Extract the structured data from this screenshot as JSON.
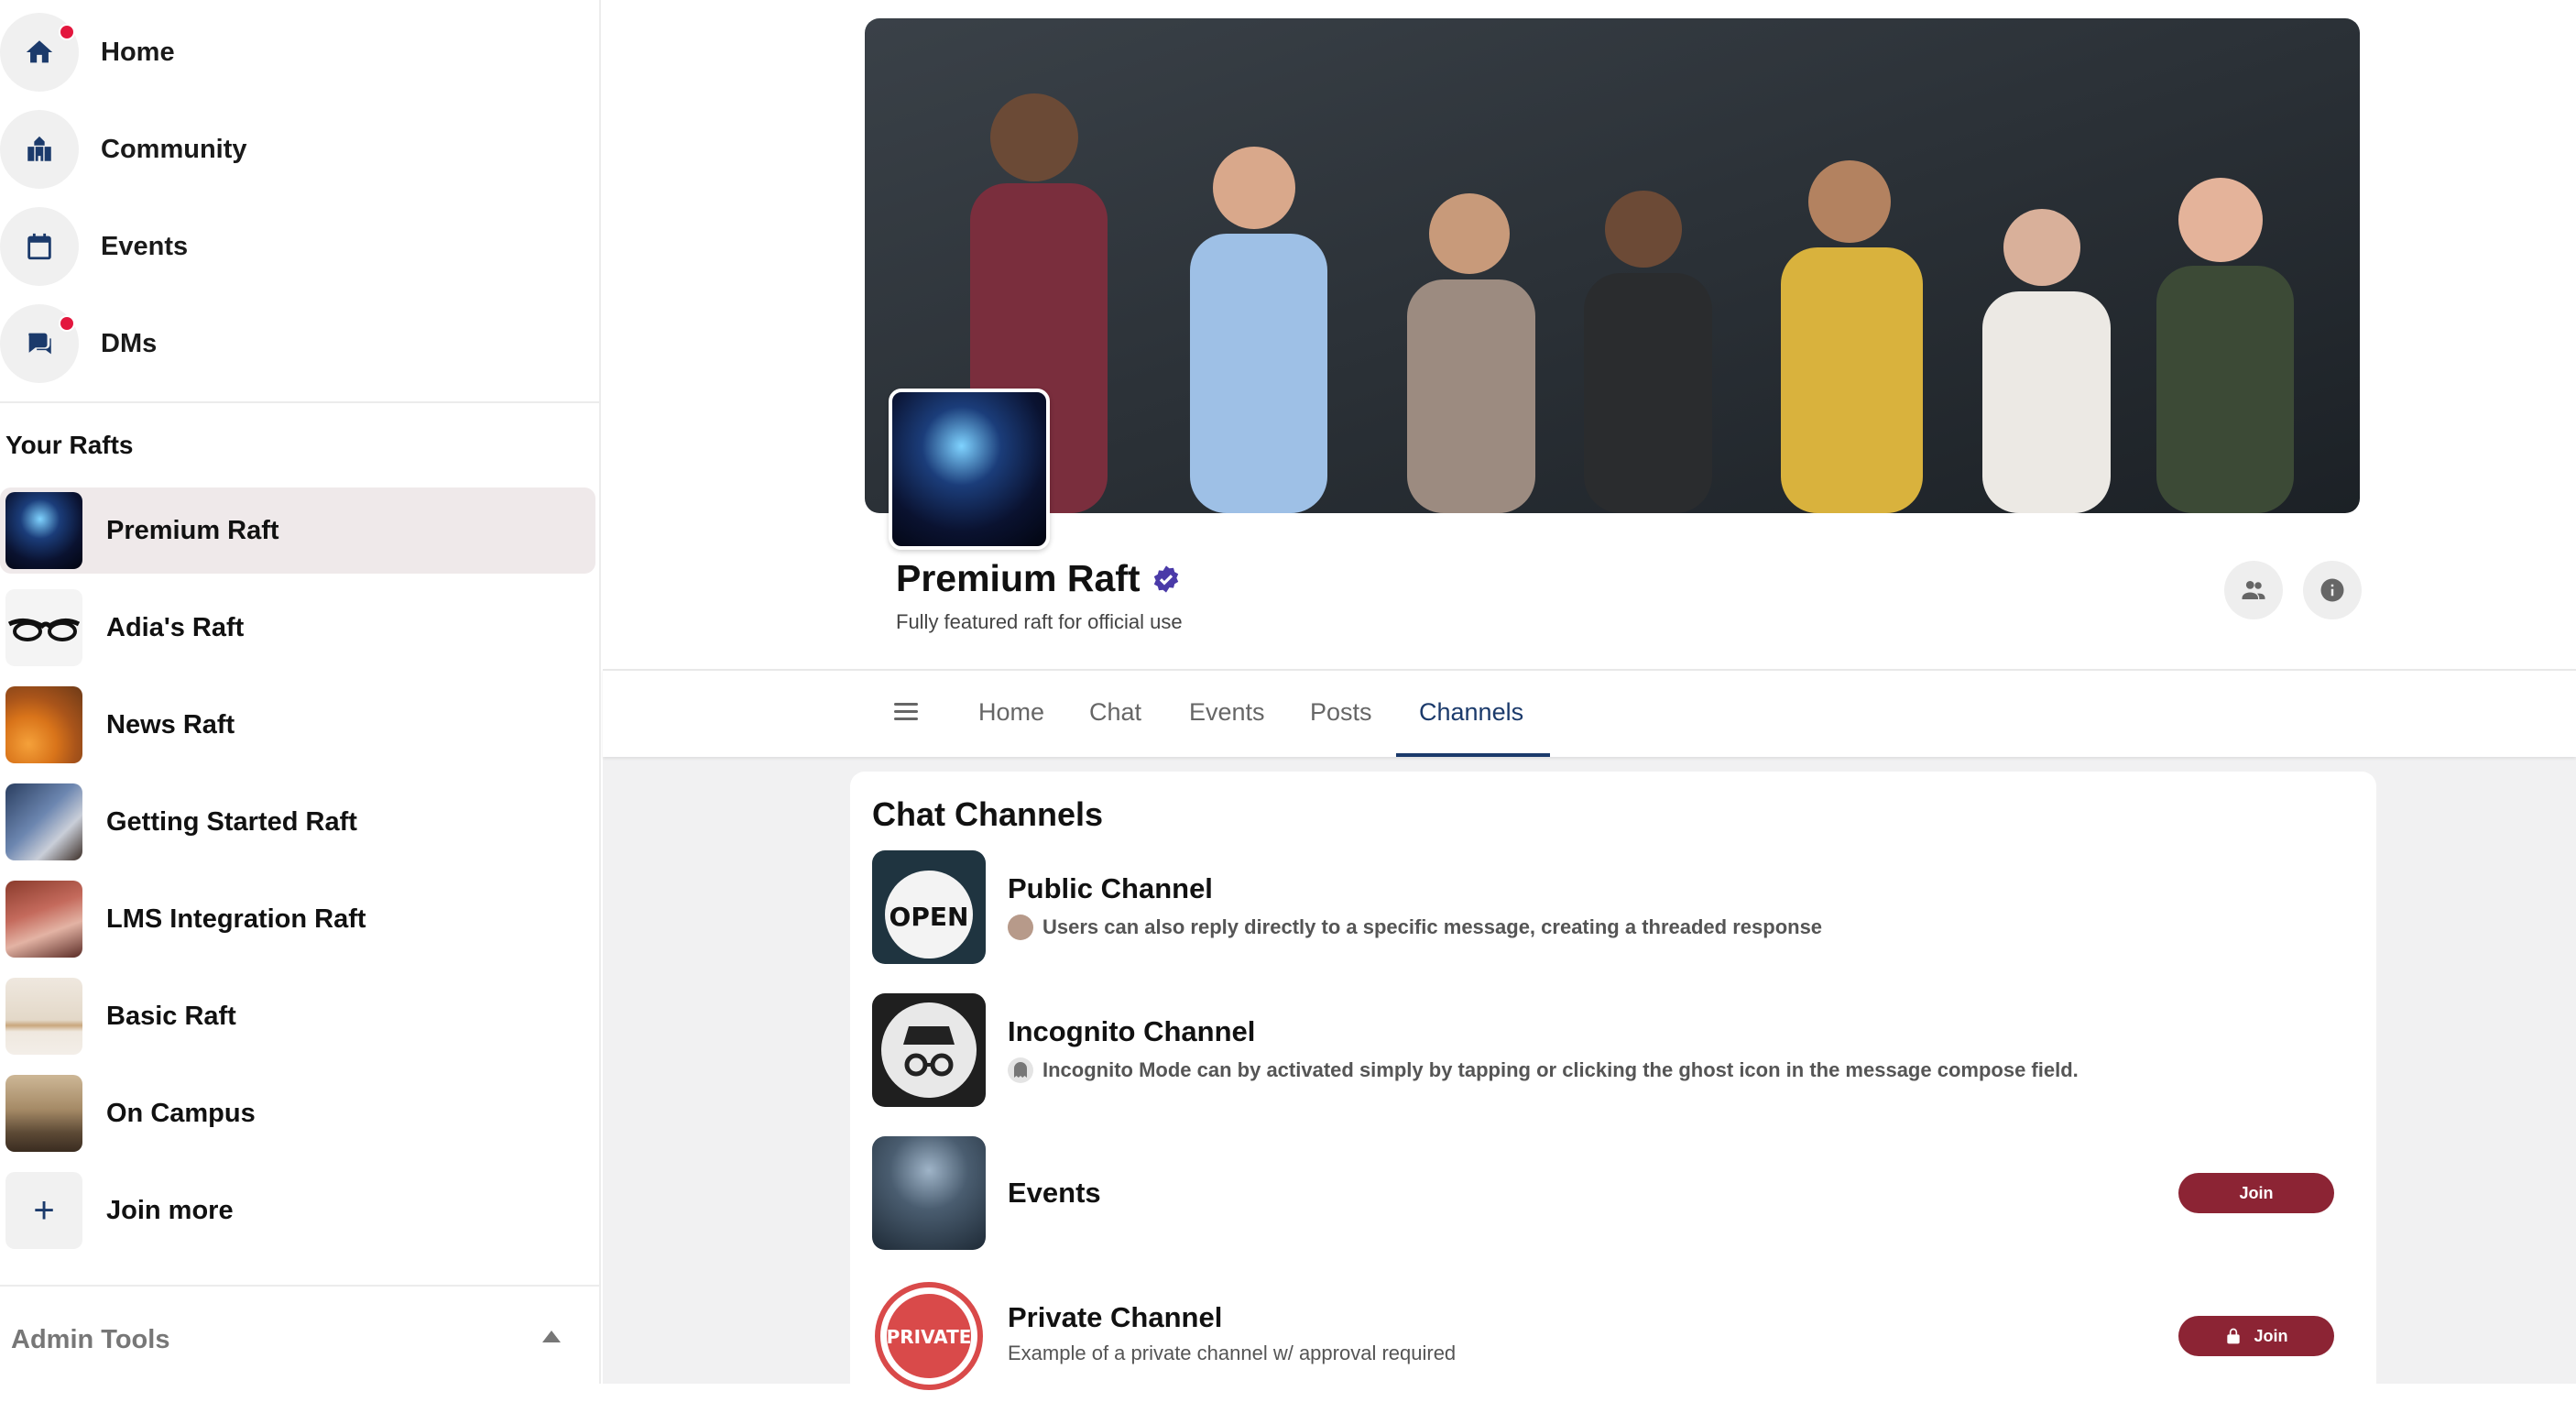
{
  "sidebar": {
    "nav": [
      {
        "label": "Home",
        "icon": "home-icon",
        "dot": true
      },
      {
        "label": "Community",
        "icon": "community-icon",
        "dot": false
      },
      {
        "label": "Events",
        "icon": "calendar-icon",
        "dot": false
      },
      {
        "label": "DMs",
        "icon": "chat-icon",
        "dot": true
      }
    ],
    "rafts_title": "Your Rafts",
    "rafts": [
      {
        "label": "Premium Raft",
        "active": true
      },
      {
        "label": "Adia's Raft"
      },
      {
        "label": "News Raft"
      },
      {
        "label": "Getting Started Raft"
      },
      {
        "label": "LMS Integration Raft"
      },
      {
        "label": "Basic Raft"
      },
      {
        "label": "On Campus"
      }
    ],
    "join_more": "Join more",
    "join_more_icon": "+",
    "admin_tools": "Admin Tools"
  },
  "raft": {
    "title": "Premium Raft",
    "subtitle": "Fully featured raft for official use",
    "verified_icon": "verified-badge-icon"
  },
  "tabs": [
    "Home",
    "Chat",
    "Events",
    "Posts",
    "Channels"
  ],
  "active_tab": "Channels",
  "channels": {
    "title": "Chat Channels",
    "items": [
      {
        "name": "Public Channel",
        "desc": "Users can also reply directly to a specific message, creating a threaded response",
        "thumb_text": "OPEN"
      },
      {
        "name": "Incognito Channel",
        "desc": "Incognito Mode can by activated simply by tapping or clicking the ghost icon in the message compose field."
      },
      {
        "name": "Events",
        "button": "Join"
      },
      {
        "name": "Private Channel",
        "desc": "Example of a private channel w/ approval required",
        "button": "Join",
        "thumb_text": "PRIVATE"
      }
    ]
  },
  "colors": {
    "accent": "#1b3a6b",
    "join": "#8c2434",
    "notify": "#e3173e"
  }
}
